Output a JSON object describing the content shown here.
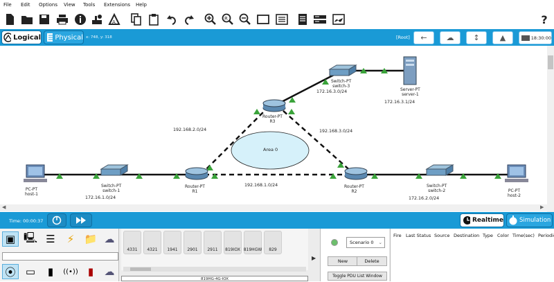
{
  "menu": [
    "File",
    "Edit",
    "Options",
    "View",
    "Tools",
    "Extensions",
    "Help"
  ],
  "toolbar_icons": [
    "new-file-icon",
    "open-folder-icon",
    "save-icon",
    "print-icon",
    "info-icon",
    "network-wizard-icon",
    "activity-wizard-icon",
    "copy-icon",
    "paste-icon",
    "undo-icon",
    "redo-icon",
    "zoom-in-icon",
    "zoom-reset-icon",
    "zoom-out-icon",
    "drawing-palette-icon",
    "custom-device-dialog-icon",
    "view-pdu-list-icon",
    "physical-device-icon",
    "cluster-icon"
  ],
  "help_glyph": "?",
  "modebar": {
    "logical_label": "Logical",
    "physical_label": "Physical",
    "coords": "x: 748, y: 318",
    "root_label": "[Root]",
    "clock": "18:30:00"
  },
  "topology": {
    "devices": [
      {
        "id": "host1",
        "type": "PC-PT",
        "name": "host-1"
      },
      {
        "id": "switch1",
        "type": "Switch-PT",
        "name": "switch-1"
      },
      {
        "id": "r1",
        "type": "Router-PT",
        "name": "R1"
      },
      {
        "id": "r2",
        "type": "Router-PT",
        "name": "R2"
      },
      {
        "id": "r3",
        "type": "Router-PT",
        "name": "R3"
      },
      {
        "id": "switch2",
        "type": "Switch-PT",
        "name": "switch-2"
      },
      {
        "id": "host2",
        "type": "PC-PT",
        "name": "host-2"
      },
      {
        "id": "switch3",
        "type": "Switch-PT",
        "name": "switch-3"
      },
      {
        "id": "server1",
        "type": "Server-PT",
        "name": "server-1"
      }
    ],
    "networks": {
      "n_sw1": "172.16.1.0/24",
      "n_sw2": "172.16.2.0/24",
      "n_sw3": "172.16.3.0/24",
      "n_srv": "172.16.3.1/24",
      "n_r1r3": "192.168.2.0/24",
      "n_r2r3": "192.168.3.0/24",
      "n_r1r2": "192.168.1.0/24"
    },
    "area_label": "Area 0"
  },
  "simbar": {
    "time_label": "Time: 00:00:37",
    "realtime_label": "Realtime",
    "simulation_label": "Simulation"
  },
  "device_models": [
    "4331",
    "4321",
    "1941",
    "2901",
    "2911",
    "819IOX",
    "819HGW",
    "829"
  ],
  "bottom_caption": "819HG-4G-IOX",
  "scenario": {
    "selected": "Scenario 0",
    "new_label": "New",
    "delete_label": "Delete",
    "toggle_label": "Toggle PDU List Window"
  },
  "pdu_columns": [
    "Fire",
    "Last Status",
    "Source",
    "Destination",
    "Type",
    "Color",
    "Time(sec)",
    "Periodic"
  ],
  "colors": {
    "accent": "#1a9ad6",
    "link_green": "#3aa33a",
    "area_fill": "#d6f1fa"
  }
}
